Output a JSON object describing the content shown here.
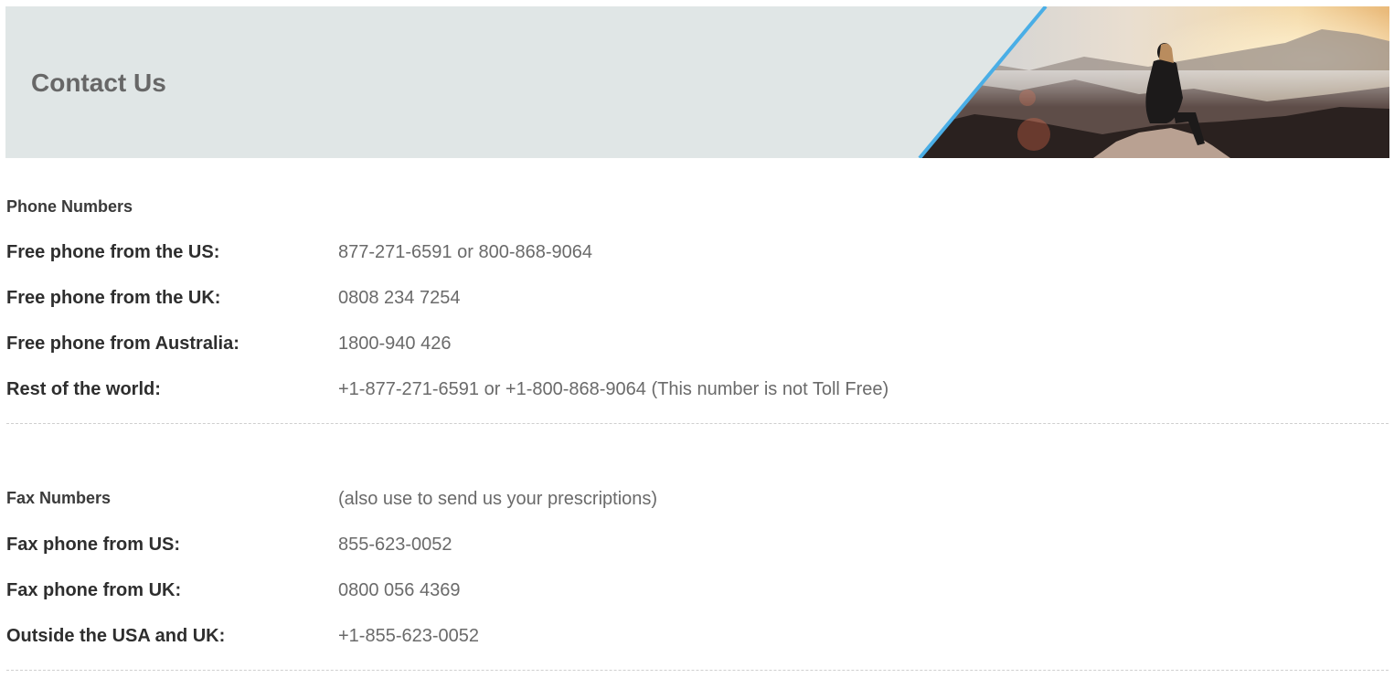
{
  "banner": {
    "title": "Contact Us"
  },
  "phone": {
    "heading": "Phone Numbers",
    "rows": [
      {
        "label": "Free phone from the US:",
        "value": "877-271-6591 or 800-868-9064"
      },
      {
        "label": "Free phone from the UK:",
        "value": "0808 234 7254"
      },
      {
        "label": "Free phone from Australia:",
        "value": "1800-940 426"
      },
      {
        "label": "Rest of the world:",
        "value": "+1-877-271-6591 or +1-800-868-9064 (This number is not Toll Free)"
      }
    ]
  },
  "fax": {
    "heading": "Fax Numbers",
    "note": "(also use to send us your prescriptions)",
    "rows": [
      {
        "label": "Fax phone from US:",
        "value": "855-623-0052"
      },
      {
        "label": "Fax phone from UK:",
        "value": "0800 056 4369"
      },
      {
        "label": "Outside the USA and UK:",
        "value": "+1-855-623-0052"
      }
    ]
  },
  "colors": {
    "banner_bg": "#e0e6e6",
    "accent_stripe": "#4aaee6",
    "title_text": "#676767"
  }
}
